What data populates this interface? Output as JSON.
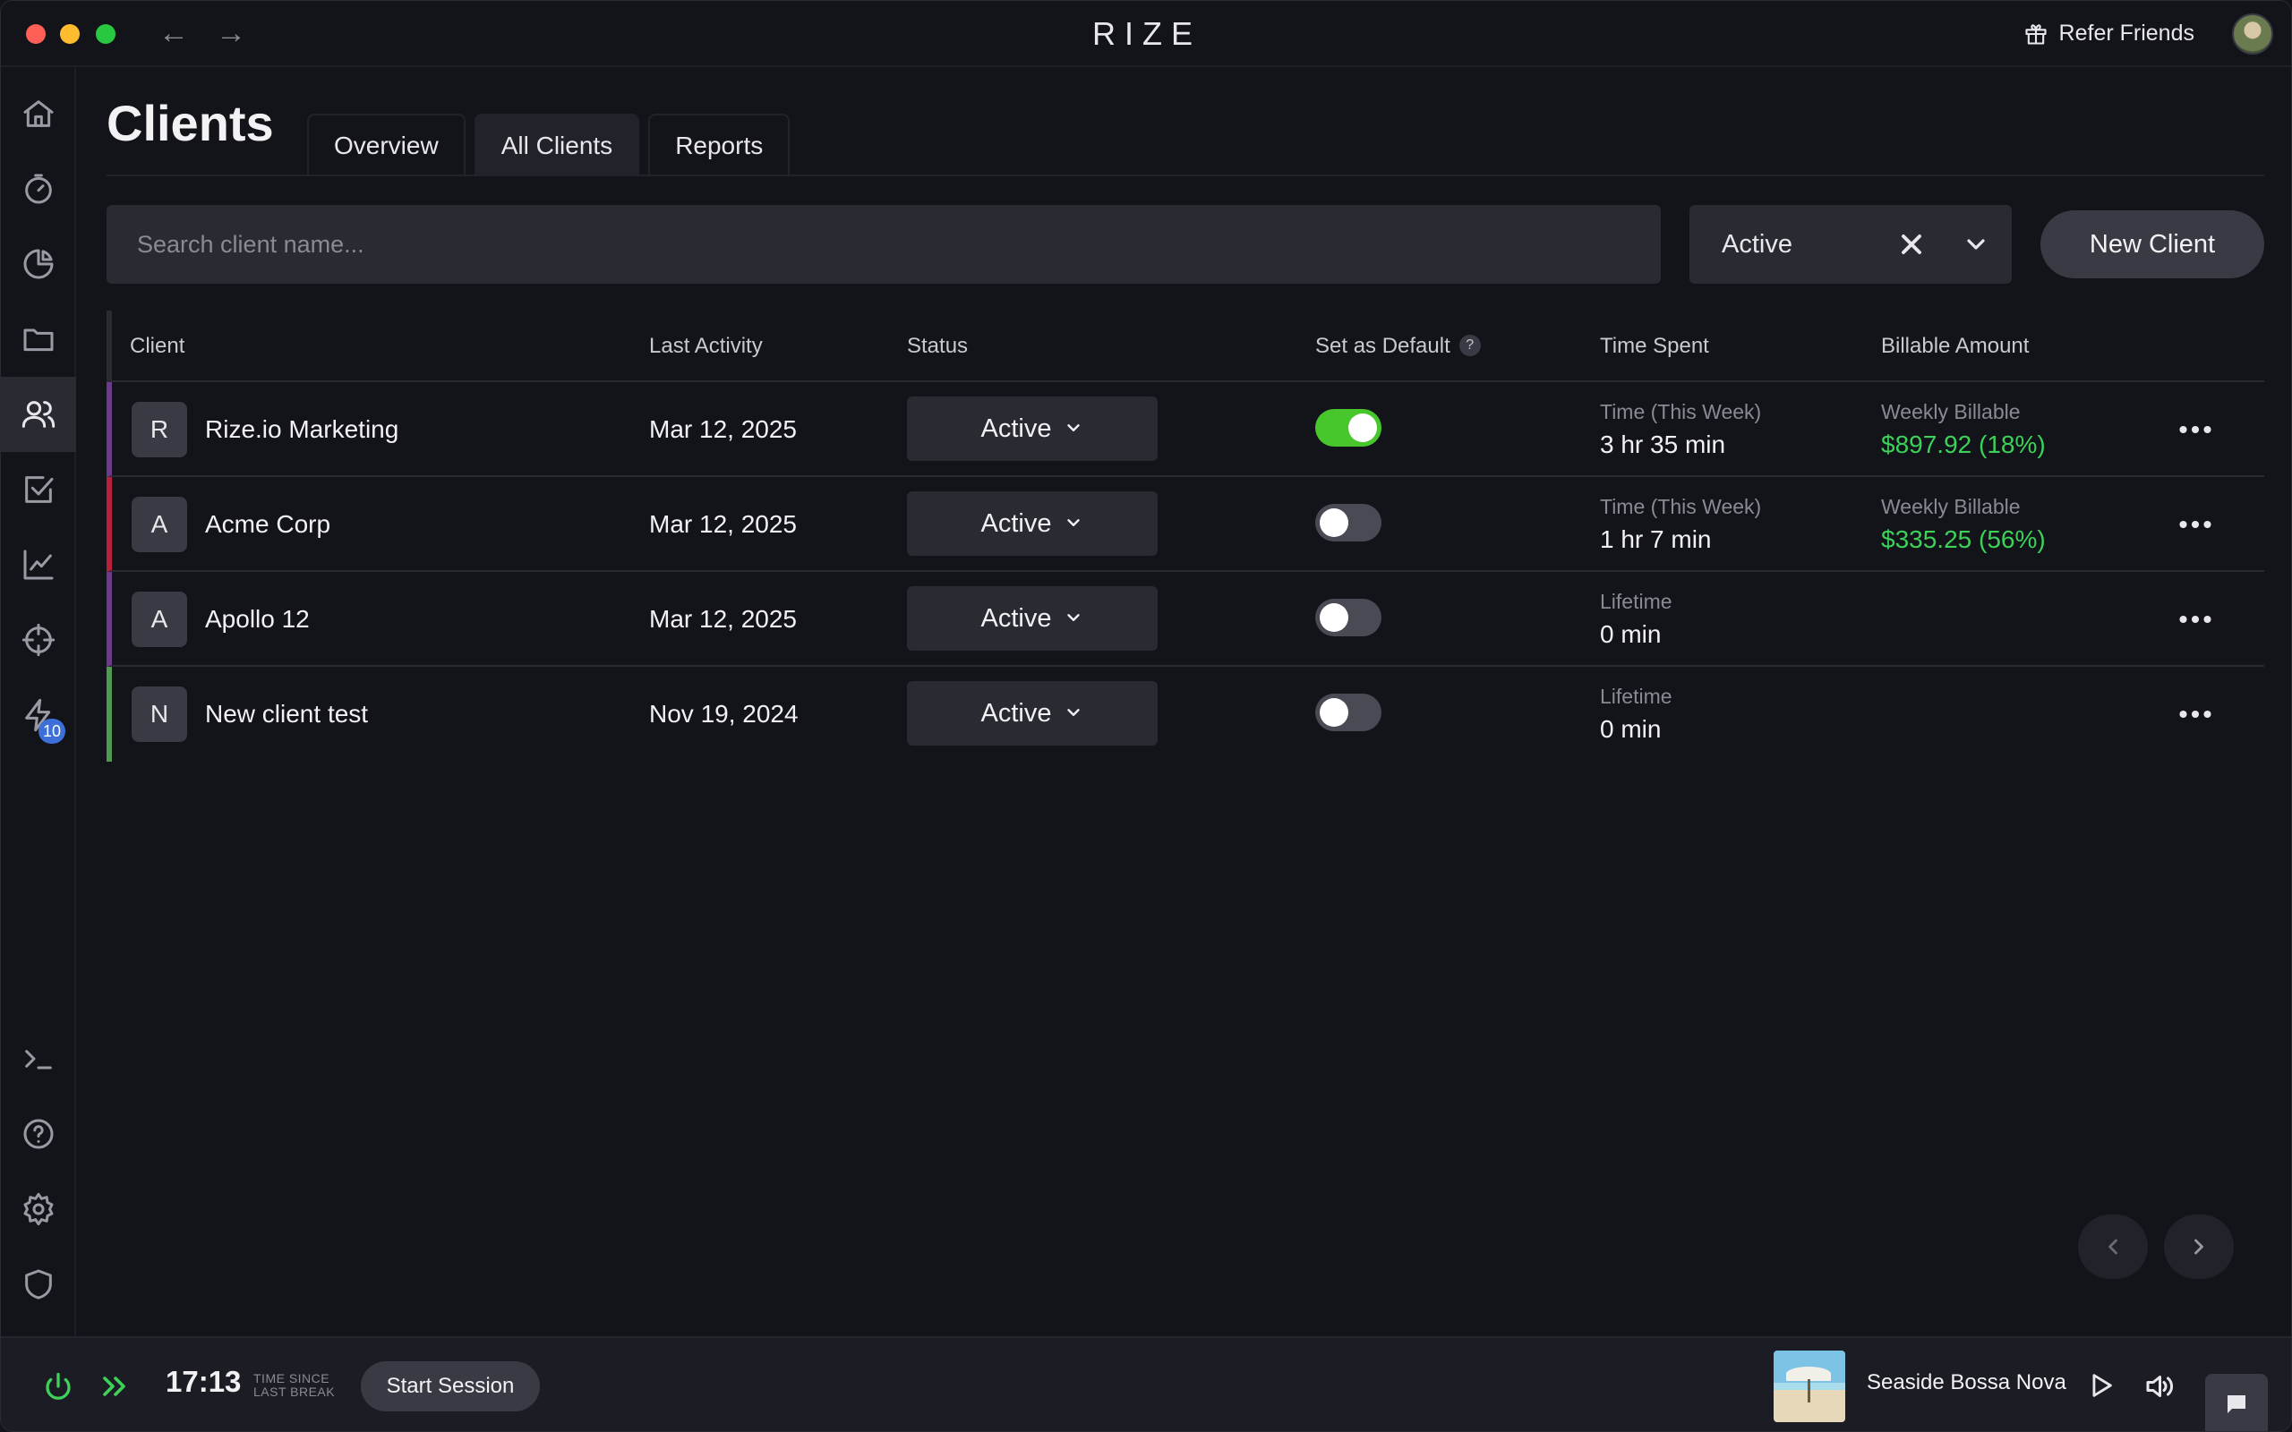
{
  "app": {
    "logo": "RIZE",
    "refer_label": "Refer Friends"
  },
  "sidebar": {
    "items": [
      {
        "name": "home-icon"
      },
      {
        "name": "timer-icon"
      },
      {
        "name": "pie-chart-icon"
      },
      {
        "name": "folder-icon"
      },
      {
        "name": "users-icon",
        "active": true
      },
      {
        "name": "task-check-icon"
      },
      {
        "name": "trend-chart-icon"
      },
      {
        "name": "target-icon"
      },
      {
        "name": "lightning-icon",
        "badge": "10"
      },
      {
        "name": "terminal-icon"
      },
      {
        "name": "help-icon"
      },
      {
        "name": "settings-icon"
      },
      {
        "name": "shield-icon"
      }
    ]
  },
  "page": {
    "title": "Clients",
    "tabs": [
      {
        "label": "Overview"
      },
      {
        "label": "All Clients",
        "active": true
      },
      {
        "label": "Reports"
      }
    ]
  },
  "toolbar": {
    "search_placeholder": "Search client name...",
    "filter_value": "Active",
    "new_client_label": "New Client"
  },
  "table": {
    "columns": {
      "client": "Client",
      "last_activity": "Last Activity",
      "status": "Status",
      "default": "Set as Default",
      "default_help": "?",
      "time_spent": "Time Spent",
      "billable": "Billable Amount"
    },
    "rows": [
      {
        "initial": "R",
        "name": "Rize.io Marketing",
        "last_activity": "Mar 12, 2025",
        "status": "Active",
        "default_on": true,
        "time_label": "Time (This Week)",
        "time_value": "3 hr 35 min",
        "billable_label": "Weekly Billable",
        "billable_value": "$897.92 (18%)",
        "color": "#6b3a8a"
      },
      {
        "initial": "A",
        "name": "Acme Corp",
        "last_activity": "Mar 12, 2025",
        "status": "Active",
        "default_on": false,
        "time_label": "Time (This Week)",
        "time_value": "1 hr 7 min",
        "billable_label": "Weekly Billable",
        "billable_value": "$335.25 (56%)",
        "color": "#b81f3a"
      },
      {
        "initial": "A",
        "name": "Apollo 12",
        "last_activity": "Mar 12, 2025",
        "status": "Active",
        "default_on": false,
        "time_label": "Lifetime",
        "time_value": "0 min",
        "billable_label": "",
        "billable_value": "",
        "color": "#6b3a8a"
      },
      {
        "initial": "N",
        "name": "New client test",
        "last_activity": "Nov 19, 2024",
        "status": "Active",
        "default_on": false,
        "time_label": "Lifetime",
        "time_value": "0 min",
        "billable_label": "",
        "billable_value": "",
        "color": "#4f9a4f"
      }
    ]
  },
  "bottom": {
    "timer": "17:13",
    "timer_label_1": "TIME SINCE",
    "timer_label_2": "LAST BREAK",
    "start_session_label": "Start Session",
    "song": "Seaside Bossa Nova"
  },
  "colors": {
    "accent_green": "#3dd15a",
    "toggle_on": "#48c72c",
    "badge_blue": "#3c6fd8"
  }
}
